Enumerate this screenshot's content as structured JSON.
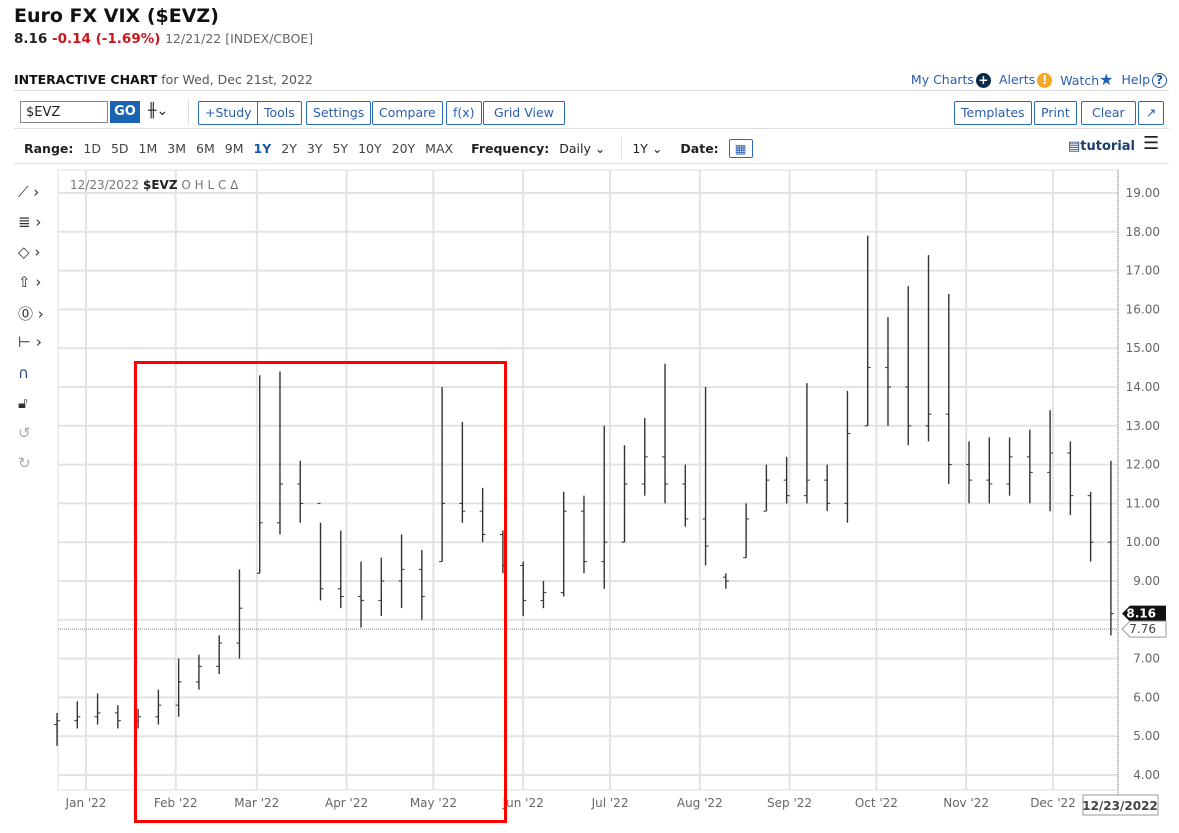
{
  "header": {
    "title": "Euro FX VIX ($EVZ)",
    "last": "8.16",
    "change": "-0.14 (-1.69%)",
    "date_exchange": "12/21/22 [INDEX/CBOE]"
  },
  "subheader": {
    "label": "INTERACTIVE CHART",
    "for_date": "for Wed, Dec 21st, 2022"
  },
  "top_links": [
    "My Charts",
    "Alerts",
    "Watch",
    "Help"
  ],
  "toolbar": {
    "symbol": "$EVZ",
    "go": "GO",
    "buttons": [
      "+Study",
      "Tools",
      "Settings",
      "Compare",
      "f(x)",
      "Grid View"
    ],
    "right_buttons": [
      "Templates",
      "Print",
      "Clear"
    ]
  },
  "range_bar": {
    "range_label": "Range:",
    "ranges": [
      "1D",
      "5D",
      "1M",
      "3M",
      "6M",
      "9M",
      "1Y",
      "2Y",
      "3Y",
      "5Y",
      "10Y",
      "20Y",
      "MAX"
    ],
    "selected": "1Y",
    "frequency_label": "Frequency:",
    "frequency": "Daily",
    "period": "1Y",
    "date_label": "Date:",
    "tutorial": "tutorial"
  },
  "legend": {
    "date": "12/23/2022",
    "symbol": "$EVZ",
    "fields": "O H L C Δ"
  },
  "colors": {
    "accent": "#1a64b4",
    "down": "#c8161d",
    "bars": "#333333",
    "highlight_box": "#ff0000"
  },
  "chart_data": {
    "type": "ohlc",
    "frequency": "weekly approximation of daily bars",
    "ylim": [
      4,
      19
    ],
    "y_ticks": [
      "19.00",
      "18.00",
      "17.00",
      "16.00",
      "15.00",
      "14.00",
      "13.00",
      "12.00",
      "11.00",
      "10.00",
      "9.00",
      "8.00",
      "7.00",
      "6.00",
      "5.00",
      "4.00"
    ],
    "x_ticks": [
      {
        "label": "Jan '22",
        "date": "2022-01-01"
      },
      {
        "label": "Feb '22",
        "date": "2022-02-01"
      },
      {
        "label": "Mar '22",
        "date": "2022-03-01"
      },
      {
        "label": "Apr '22",
        "date": "2022-04-01"
      },
      {
        "label": "May '22",
        "date": "2022-05-01"
      },
      {
        "label": "Jun '22",
        "date": "2022-06-01"
      },
      {
        "label": "Jul '22",
        "date": "2022-07-01"
      },
      {
        "label": "Aug '22",
        "date": "2022-08-01"
      },
      {
        "label": "Sep '22",
        "date": "2022-09-01"
      },
      {
        "label": "Oct '22",
        "date": "2022-10-01"
      },
      {
        "label": "Nov '22",
        "date": "2022-11-01"
      },
      {
        "label": "Dec '22",
        "date": "2022-12-01"
      }
    ],
    "last_price": "8.16",
    "reference_line": "7.76",
    "end_date": "12/23/2022",
    "bars": [
      [
        "2021-12-20",
        5.3,
        5.6,
        4.75,
        5.4
      ],
      [
        "2021-12-27",
        5.4,
        5.9,
        5.2,
        5.5
      ],
      [
        "2022-01-03",
        5.5,
        6.1,
        5.3,
        5.6
      ],
      [
        "2022-01-10",
        5.6,
        5.8,
        5.2,
        5.4
      ],
      [
        "2022-01-17",
        5.4,
        5.7,
        5.2,
        5.5
      ],
      [
        "2022-01-24",
        5.5,
        6.2,
        5.3,
        5.8
      ],
      [
        "2022-01-31",
        5.8,
        7.0,
        5.5,
        6.4
      ],
      [
        "2022-02-07",
        6.4,
        7.1,
        6.2,
        6.8
      ],
      [
        "2022-02-14",
        6.8,
        7.6,
        6.6,
        7.4
      ],
      [
        "2022-02-21",
        7.4,
        9.3,
        7.0,
        8.3
      ],
      [
        "2022-02-28",
        9.2,
        14.3,
        9.2,
        10.5
      ],
      [
        "2022-03-07",
        10.5,
        14.4,
        10.2,
        11.5
      ],
      [
        "2022-03-14",
        11.5,
        12.1,
        10.5,
        11.0
      ],
      [
        "2022-03-21",
        11.0,
        10.5,
        8.5,
        8.8
      ],
      [
        "2022-03-28",
        8.8,
        10.3,
        8.3,
        8.6
      ],
      [
        "2022-04-04",
        8.6,
        9.5,
        7.8,
        8.5
      ],
      [
        "2022-04-11",
        8.5,
        9.6,
        8.1,
        9.0
      ],
      [
        "2022-04-18",
        9.0,
        10.2,
        8.3,
        9.3
      ],
      [
        "2022-04-25",
        9.3,
        9.8,
        8.0,
        8.6
      ],
      [
        "2022-05-02",
        9.5,
        14.0,
        9.5,
        11.0
      ],
      [
        "2022-05-09",
        11.0,
        13.1,
        10.5,
        10.8
      ],
      [
        "2022-05-16",
        10.8,
        11.4,
        10.0,
        10.2
      ],
      [
        "2022-05-23",
        10.2,
        10.3,
        9.2,
        9.4
      ],
      [
        "2022-05-30",
        9.4,
        9.5,
        8.1,
        8.5
      ],
      [
        "2022-06-06",
        8.5,
        9.0,
        8.3,
        8.7
      ],
      [
        "2022-06-13",
        8.7,
        11.3,
        8.6,
        10.8
      ],
      [
        "2022-06-20",
        10.8,
        11.2,
        9.2,
        9.5
      ],
      [
        "2022-06-27",
        9.5,
        13.0,
        8.8,
        10.0
      ],
      [
        "2022-07-04",
        10.0,
        12.5,
        10.0,
        11.5
      ],
      [
        "2022-07-11",
        11.5,
        13.2,
        11.2,
        12.2
      ],
      [
        "2022-07-18",
        12.2,
        14.6,
        11.0,
        11.5
      ],
      [
        "2022-07-25",
        11.5,
        12.0,
        10.4,
        10.6
      ],
      [
        "2022-08-01",
        10.6,
        14.0,
        9.4,
        9.9
      ],
      [
        "2022-08-08",
        9.1,
        9.2,
        8.8,
        9.0
      ],
      [
        "2022-08-15",
        9.6,
        11.0,
        9.6,
        10.6
      ],
      [
        "2022-08-22",
        10.8,
        12.0,
        10.8,
        11.6
      ],
      [
        "2022-08-29",
        11.6,
        12.2,
        11.0,
        11.2
      ],
      [
        "2022-09-05",
        11.2,
        14.1,
        11.0,
        11.6
      ],
      [
        "2022-09-12",
        11.6,
        12.0,
        10.8,
        11.0
      ],
      [
        "2022-09-19",
        11.0,
        13.9,
        10.5,
        12.8
      ],
      [
        "2022-09-26",
        13.0,
        17.9,
        13.0,
        14.5
      ],
      [
        "2022-10-03",
        14.5,
        15.8,
        13.0,
        14.0
      ],
      [
        "2022-10-10",
        14.0,
        16.6,
        12.5,
        13.0
      ],
      [
        "2022-10-17",
        13.0,
        17.4,
        12.6,
        13.3
      ],
      [
        "2022-10-24",
        13.3,
        16.4,
        11.5,
        12.0
      ],
      [
        "2022-10-31",
        12.0,
        12.6,
        11.0,
        11.6
      ],
      [
        "2022-11-07",
        11.6,
        12.7,
        11.0,
        11.5
      ],
      [
        "2022-11-14",
        11.5,
        12.7,
        11.2,
        12.2
      ],
      [
        "2022-11-21",
        12.2,
        12.9,
        11.0,
        11.8
      ],
      [
        "2022-11-28",
        11.8,
        13.4,
        10.8,
        12.3
      ],
      [
        "2022-12-05",
        12.3,
        12.6,
        10.7,
        11.2
      ],
      [
        "2022-12-12",
        11.2,
        11.3,
        9.5,
        10.0
      ],
      [
        "2022-12-19",
        10.0,
        12.1,
        7.6,
        8.16
      ]
    ]
  }
}
